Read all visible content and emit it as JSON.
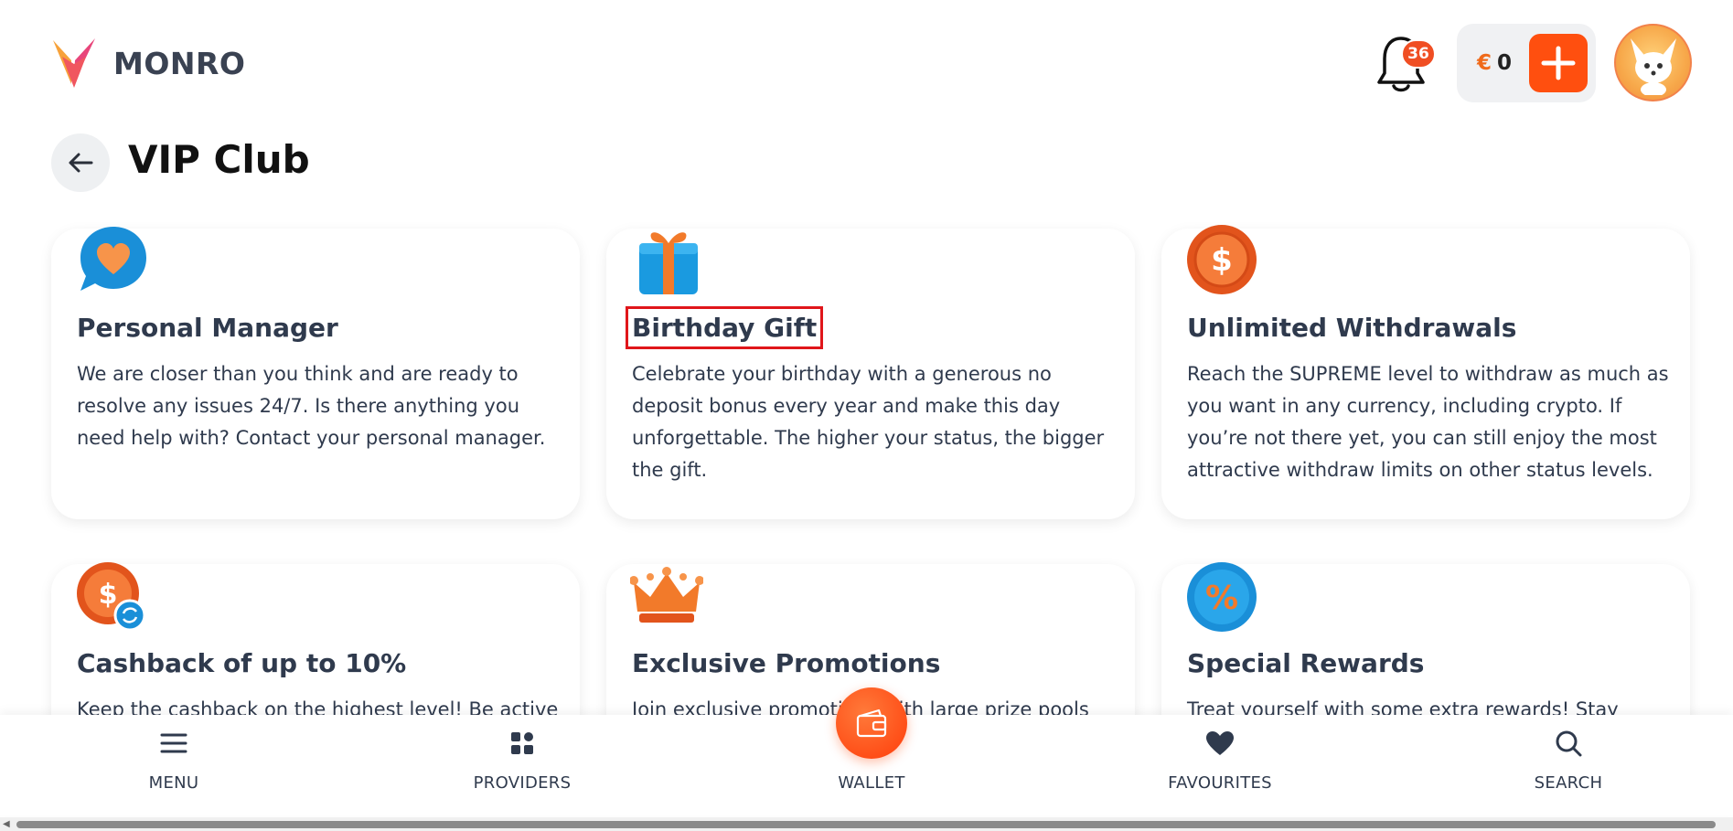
{
  "header": {
    "brand": "MONRO",
    "notifications_count": "36",
    "currency_symbol": "€",
    "balance": "0"
  },
  "page": {
    "title": "VIP Club"
  },
  "cards": [
    {
      "title": "Personal Manager",
      "text": "We are closer than you think and are ready to resolve any issues 24/7. Is there anything you need help with? Contact your personal manager.",
      "icon": "heart-chat-icon"
    },
    {
      "title": "Birthday Gift",
      "text": "Celebrate your birthday with a generous no deposit bonus every year and make this day unforgettable. The higher your status, the bigger the gift.",
      "icon": "gift-icon"
    },
    {
      "title": "Unlimited Withdrawals",
      "text": "Reach the SUPREME level to withdraw as much as you want in any currency, including crypto. If you’re not there yet, you can still enjoy the most attractive withdraw limits on other status levels.",
      "icon": "dollar-coin-icon"
    },
    {
      "title": "Cashback of up to 10%",
      "text": "Keep the cashback on the highest level! Be active by",
      "icon": "cashback-coin-icon"
    },
    {
      "title": "Exclusive Promotions",
      "text": "Join exclusive promotions with large prize pools and",
      "icon": "crown-icon"
    },
    {
      "title": "Special Rewards",
      "text": "Treat yourself with some extra rewards! Stay active",
      "icon": "percent-coin-icon"
    }
  ],
  "bottom_nav": {
    "menu": "MENU",
    "providers": "PROVIDERS",
    "wallet": "WALLET",
    "favourites": "FAVOURITES",
    "search": "SEARCH"
  },
  "colors": {
    "accent": "#ff4f0f",
    "highlight_border": "#e0161b"
  }
}
